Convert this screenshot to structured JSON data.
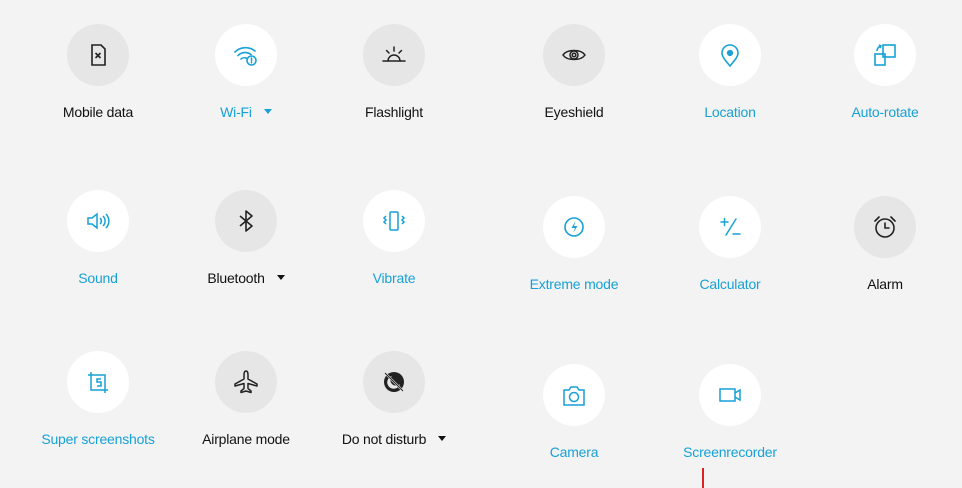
{
  "colors": {
    "active": "#17a1d6",
    "inactive": "#222222",
    "active_bg": "#ffffff",
    "inactive_bg": "#e6e6e6",
    "panel_bg": "#f3f3f3"
  },
  "tiles": [
    {
      "id": "mobile-data",
      "label": "Mobile data",
      "icon": "sim-off-icon",
      "active": false
    },
    {
      "id": "wifi",
      "label": "Wi-Fi",
      "icon": "wifi-icon",
      "active": true,
      "has_dropdown": true
    },
    {
      "id": "flashlight",
      "label": "Flashlight",
      "icon": "flashlight-icon",
      "active": false
    },
    {
      "id": "eyeshield",
      "label": "Eyeshield",
      "icon": "eye-icon",
      "active": false
    },
    {
      "id": "location",
      "label": "Location",
      "icon": "location-pin-icon",
      "active": true
    },
    {
      "id": "auto-rotate",
      "label": "Auto-rotate",
      "icon": "auto-rotate-icon",
      "active": true
    },
    {
      "id": "sound",
      "label": "Sound",
      "icon": "speaker-icon",
      "active": true
    },
    {
      "id": "bluetooth",
      "label": "Bluetooth",
      "icon": "bluetooth-icon",
      "active": false,
      "has_dropdown": true
    },
    {
      "id": "vibrate",
      "label": "Vibrate",
      "icon": "vibrate-icon",
      "active": true
    },
    {
      "id": "extreme-mode",
      "label": "Extreme mode",
      "icon": "power-saving-icon",
      "active": true
    },
    {
      "id": "calculator",
      "label": "Calculator",
      "icon": "calculator-icon",
      "active": true
    },
    {
      "id": "alarm",
      "label": "Alarm",
      "icon": "alarm-clock-icon",
      "active": false
    },
    {
      "id": "super-screenshots",
      "label": "Super screenshots",
      "icon": "screenshot-icon",
      "active": true
    },
    {
      "id": "airplane-mode",
      "label": "Airplane mode",
      "icon": "airplane-icon",
      "active": false
    },
    {
      "id": "do-not-disturb",
      "label": "Do not disturb",
      "icon": "do-not-disturb-icon",
      "active": false,
      "has_dropdown": true
    },
    {
      "id": "camera",
      "label": "Camera",
      "icon": "camera-icon",
      "active": true
    },
    {
      "id": "screenrecorder",
      "label": "Screenrecorder",
      "icon": "screen-recorder-icon",
      "active": true
    }
  ]
}
